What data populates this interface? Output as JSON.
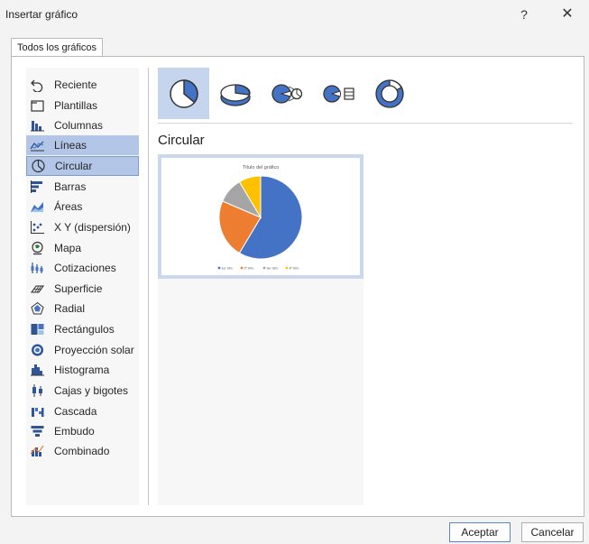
{
  "window": {
    "title": "Insertar gráfico",
    "help": "?",
    "close": "✕"
  },
  "tab": {
    "label": "Todos los gráficos"
  },
  "categories": [
    {
      "label": "Reciente",
      "icon": "recent-icon"
    },
    {
      "label": "Plantillas",
      "icon": "templates-icon"
    },
    {
      "label": "Columnas",
      "icon": "column-chart-icon"
    },
    {
      "label": "Líneas",
      "icon": "line-chart-icon"
    },
    {
      "label": "Circular",
      "icon": "pie-chart-icon"
    },
    {
      "label": "Barras",
      "icon": "bar-chart-icon"
    },
    {
      "label": "Áreas",
      "icon": "area-chart-icon"
    },
    {
      "label": "X Y (dispersión)",
      "icon": "scatter-chart-icon"
    },
    {
      "label": "Mapa",
      "icon": "map-chart-icon"
    },
    {
      "label": "Cotizaciones",
      "icon": "stock-chart-icon"
    },
    {
      "label": "Superficie",
      "icon": "surface-chart-icon"
    },
    {
      "label": "Radial",
      "icon": "radar-chart-icon"
    },
    {
      "label": "Rectángulos",
      "icon": "treemap-chart-icon"
    },
    {
      "label": "Proyección solar",
      "icon": "sunburst-chart-icon"
    },
    {
      "label": "Histograma",
      "icon": "histogram-chart-icon"
    },
    {
      "label": "Cajas y bigotes",
      "icon": "box-whisker-chart-icon"
    },
    {
      "label": "Cascada",
      "icon": "waterfall-chart-icon"
    },
    {
      "label": "Embudo",
      "icon": "funnel-chart-icon"
    },
    {
      "label": "Combinado",
      "icon": "combo-chart-icon"
    }
  ],
  "state": {
    "hovered": "Líneas",
    "selected": "Circular"
  },
  "subtypes": [
    "pie-icon",
    "pie-3d-icon",
    "pie-of-pie-icon",
    "bar-of-pie-icon",
    "doughnut-icon"
  ],
  "chart_type_title": "Circular",
  "preview": {
    "title": "Título del gráfico",
    "legend": [
      "1er trim.",
      "2º trim.",
      "3er trim.",
      "4º trim."
    ],
    "colors": [
      "#4472c4",
      "#ed7d31",
      "#a5a5a5",
      "#ffc000"
    ]
  },
  "chart_data": {
    "type": "pie",
    "title": "Título del gráfico",
    "categories": [
      "1er trim.",
      "2º trim.",
      "3er trim.",
      "4º trim."
    ],
    "values": [
      8.2,
      3.2,
      1.4,
      1.2
    ]
  },
  "buttons": {
    "ok": "Aceptar",
    "cancel": "Cancelar"
  },
  "colors": {
    "accent": "#4472c4",
    "selection": "#b3c6e7"
  }
}
